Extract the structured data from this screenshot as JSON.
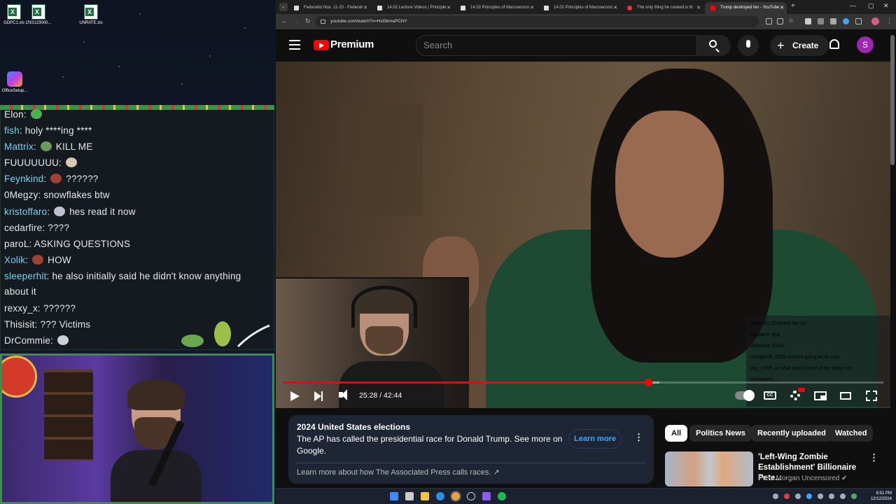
{
  "desktop": {
    "icons": [
      {
        "label": "GDPC1.xls"
      },
      {
        "label": "LNS123000..."
      },
      {
        "label": "UNRATE.xls"
      }
    ],
    "office_label": "OfficeSetup..."
  },
  "stream_chat": {
    "messages": [
      {
        "user": "Elon",
        "user_color": "#e8e8e8",
        "text": ""
      },
      {
        "user": "fish",
        "user_color": "#7ad3f0",
        "text": "holy ****ing ****"
      },
      {
        "user": "Mattrix",
        "user_color": "#7ad3f0",
        "text": "KILL ME"
      },
      {
        "user": "FUUUUUUU",
        "user_color": "#e8e8e8",
        "text": ""
      },
      {
        "user": "Feynkind",
        "user_color": "#7ad3f0",
        "text": "??????"
      },
      {
        "user": "0Megzy",
        "user_color": "#e8e8e8",
        "text": "snowflakes btw"
      },
      {
        "user": "kristoffaro",
        "user_color": "#7ad3f0",
        "text": "hes read it now"
      },
      {
        "user": "cedarfire",
        "user_color": "#e8e8e8",
        "text": "????"
      },
      {
        "user": "paroL",
        "user_color": "#e8e8e8",
        "text": "ASKING QUESTIONS"
      },
      {
        "user": "Xolik",
        "user_color": "#7ad3f0",
        "text": "HOW"
      },
      {
        "user": "sleeperhit",
        "user_color": "#7ad3f0",
        "text": "he also initially said he didn't know anything about it"
      },
      {
        "user": "rexxy_x",
        "user_color": "#e8e8e8",
        "text": "??????"
      },
      {
        "user": "Thisisit",
        "user_color": "#e8e8e8",
        "text": "??? Victims"
      },
      {
        "user": "DrCommie",
        "user_color": "#e8e8e8",
        "text": ""
      }
    ]
  },
  "browser": {
    "tabs": [
      {
        "label": "Federalist Nos. 11-20 - Federali"
      },
      {
        "label": "14.02 Lecture Videos | Principle"
      },
      {
        "label": "14.02 Principles of Macroecono"
      },
      {
        "label": "14.02 Principles of Macroecono"
      },
      {
        "label": "The only thing he cooked is th"
      },
      {
        "label": "Trump destroyed her - YouTube"
      }
    ],
    "url": "youtube.com/watch?v=Hvl3kmePCNY"
  },
  "youtube": {
    "brand": "Premium",
    "search_placeholder": "Search",
    "create_label": "Create",
    "avatar_letter": "S",
    "player": {
      "time": "25:28 / 42:44",
      "progress_fraction": 0.608,
      "buffered_fraction": 0.627,
      "overlay_chat": [
        "vetrax91: Emporor Arc inc",
        "Myoberri: eye",
        "AliasMist: KEKL",
        "metaprintt: 2025 content going to be nuts",
        "day_nuhh: At what point is one of the thing not",
        "someyami: ..."
      ]
    },
    "election_panel": {
      "title": "2024 United States elections",
      "body": "The AP has called the presidential race for Donald Trump. See more on Google.",
      "learn_more": "Learn more",
      "link": "Learn more about how The Associated Press calls races."
    },
    "chips": [
      "All",
      "Politics News",
      "Recently uploaded",
      "Watched"
    ],
    "recommendation": {
      "title": "'Left-Wing Zombie Establishment' Billionaire Pete...",
      "channel": "Piers Morgan Uncensored"
    }
  },
  "taskbar": {
    "time": "6:51 PM",
    "date": "12/12/2024"
  },
  "colors": {
    "accent_red": "#ff0000",
    "link_blue": "#3ea6ff",
    "chat_name_blue": "#7ad3f0"
  }
}
